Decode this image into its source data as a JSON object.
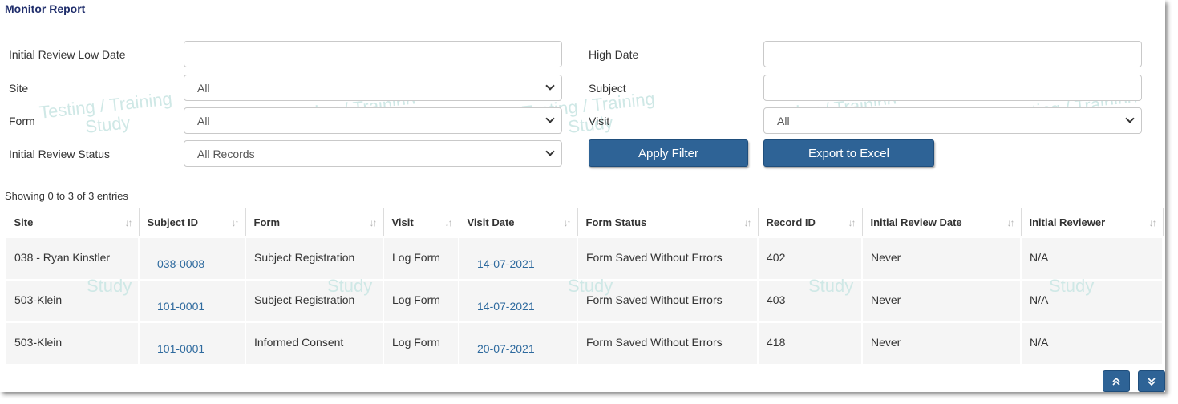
{
  "page": {
    "title": "Monitor Report"
  },
  "watermark": {
    "line1": "Testing / Training",
    "line2": "Study"
  },
  "filters": {
    "low_date_label": "Initial Review Low Date",
    "low_date_value": "",
    "high_date_label": "High Date",
    "high_date_value": "",
    "site_label": "Site",
    "site_selected": "All",
    "subject_label": "Subject",
    "subject_value": "",
    "form_label": "Form",
    "form_selected": "All",
    "visit_label": "Visit",
    "visit_selected": "All",
    "status_label": "Initial Review Status",
    "status_selected": "All Records",
    "apply_label": "Apply Filter",
    "export_label": "Export to Excel"
  },
  "table": {
    "info": "Showing 0 to 3 of 3 entries",
    "columns": [
      "Site",
      "Subject ID",
      "Form",
      "Visit",
      "Visit Date",
      "Form Status",
      "Record ID",
      "Initial Review Date",
      "Initial Reviewer"
    ],
    "rows": [
      [
        "038 - Ryan Kinstler",
        "038-0008",
        "Subject Registration",
        "Log Form",
        "14-07-2021",
        "Form Saved Without Errors",
        "402",
        "Never",
        "N/A"
      ],
      [
        "503-Klein",
        "101-0001",
        "Subject Registration",
        "Log Form",
        "14-07-2021",
        "Form Saved Without Errors",
        "403",
        "Never",
        "N/A"
      ],
      [
        "503-Klein",
        "101-0001",
        "Informed Consent",
        "Log Form",
        "20-07-2021",
        "Form Saved Without Errors",
        "418",
        "Never",
        "N/A"
      ]
    ]
  },
  "icons": {
    "sort": "sort-icon",
    "select": "chevron-down-icon",
    "up": "double-chevron-up-icon",
    "down": "double-chevron-down-icon"
  },
  "colors": {
    "title": "#1f2d6b",
    "button": "#2e6396",
    "link": "#2e6a9e",
    "row_bg": "#f5f5f5",
    "watermark": "#cfe8e6"
  }
}
